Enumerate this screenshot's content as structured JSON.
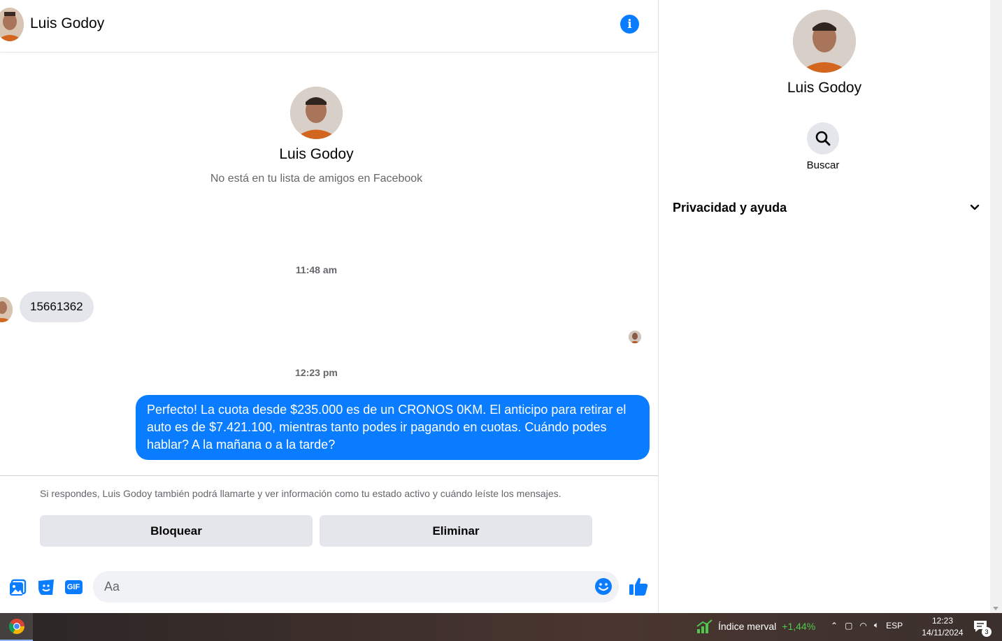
{
  "header": {
    "contact_name": "Luis Godoy"
  },
  "intro": {
    "name": "Luis Godoy",
    "subtitle": "No está en tu lista de amigos en Facebook"
  },
  "messages": {
    "timestamp_1": "11:48 am",
    "incoming_1": "15661362",
    "timestamp_2": "12:23 pm",
    "outgoing_1": "Perfecto! La cuota desde $235.000 es de un CRONOS 0KM. El anticipo para retirar el auto es de $7.421.100, mientras tanto podes ir pagando en cuotas. Cuándo podes hablar? A la mañana o a la tarde?"
  },
  "notice": "Si respondes, Luis Godoy también podrá llamarte y ver información como tu estado activo y cuándo leíste los mensajes.",
  "actions": {
    "block_label": "Bloquear",
    "delete_label": "Eliminar"
  },
  "composer": {
    "placeholder": "Aa",
    "gif_label": "GIF"
  },
  "sidebar": {
    "name": "Luis Godoy",
    "search_label": "Buscar",
    "privacy_label": "Privacidad y ayuda"
  },
  "taskbar": {
    "ticker_label": "Índice merval",
    "ticker_value": "+1,44%",
    "language": "ESP",
    "time": "12:23",
    "date": "14/11/2024",
    "notification_count": "3"
  },
  "colors": {
    "accent": "#0a7cff",
    "bubble_in": "#e4e6eb",
    "positive": "#4fc84f"
  }
}
